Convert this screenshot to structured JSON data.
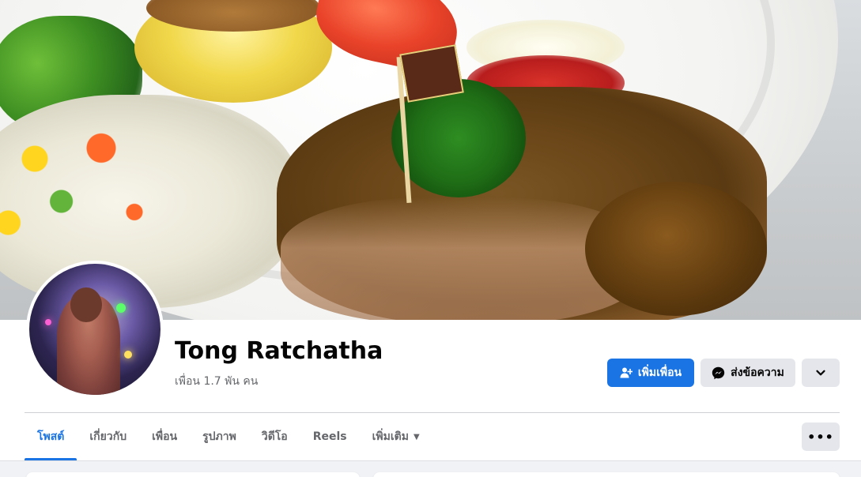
{
  "profile": {
    "name": "Tong Ratchatha",
    "friends_count": "เพื่อน 1.7 พัน คน"
  },
  "actions": {
    "add_friend_label": "เพิ่มเพื่อน",
    "message_label": "ส่งข้อความ"
  },
  "tabs": [
    {
      "label": "โพสต์",
      "active": true
    },
    {
      "label": "เกี่ยวกับ",
      "active": false
    },
    {
      "label": "เพื่อน",
      "active": false
    },
    {
      "label": "รูปภาพ",
      "active": false
    },
    {
      "label": "วิดีโอ",
      "active": false
    },
    {
      "label": "Reels",
      "active": false
    },
    {
      "label": "เพิ่มเติม",
      "active": false
    }
  ],
  "more_glyph": "•••",
  "colors": {
    "accent": "#1b74e4",
    "secondary_button": "#e4e6eb",
    "text_primary": "#050505",
    "text_secondary": "#65676b"
  },
  "icons": {
    "add_friend": "add-person-icon",
    "message": "messenger-icon",
    "dropdown": "chevron-down-icon",
    "tab_more": "caret-down-icon",
    "more": "ellipsis-icon"
  }
}
